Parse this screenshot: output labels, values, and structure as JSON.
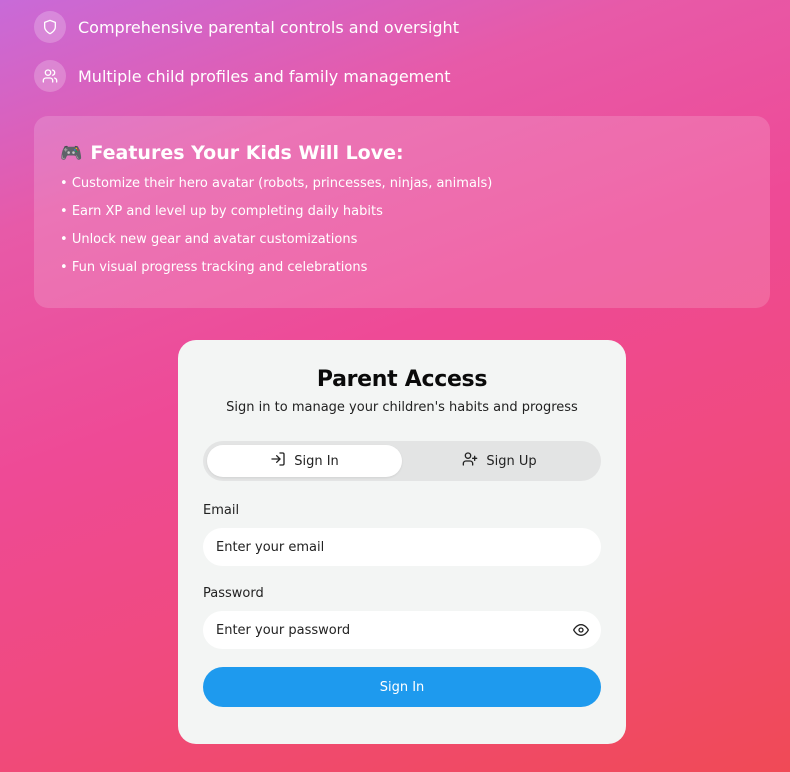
{
  "features": [
    {
      "icon": "shield-icon",
      "text": "Comprehensive parental controls and oversight"
    },
    {
      "icon": "users-icon",
      "text": "Multiple child profiles and family management"
    }
  ],
  "kids_card": {
    "emoji": "🎮",
    "title": "Features Your Kids Will Love:",
    "items": [
      "Customize their hero avatar (robots, princesses, ninjas, animals)",
      "Earn XP and level up by completing daily habits",
      "Unlock new gear and avatar customizations",
      "Fun visual progress tracking and celebrations"
    ]
  },
  "auth": {
    "title": "Parent Access",
    "subtitle": "Sign in to manage your children's habits and progress",
    "tabs": [
      {
        "label": "Sign In",
        "icon": "login-icon",
        "active": true
      },
      {
        "label": "Sign Up",
        "icon": "user-plus-icon",
        "active": false
      }
    ],
    "email_label": "Email",
    "email_placeholder": "Enter your email",
    "password_label": "Password",
    "password_placeholder": "Enter your password",
    "submit_label": "Sign In"
  },
  "colors": {
    "accent": "#1e9aee",
    "card_bg": "#f3f5f4",
    "gradient_start": "#c86ad8",
    "gradient_end": "#f04a56"
  }
}
